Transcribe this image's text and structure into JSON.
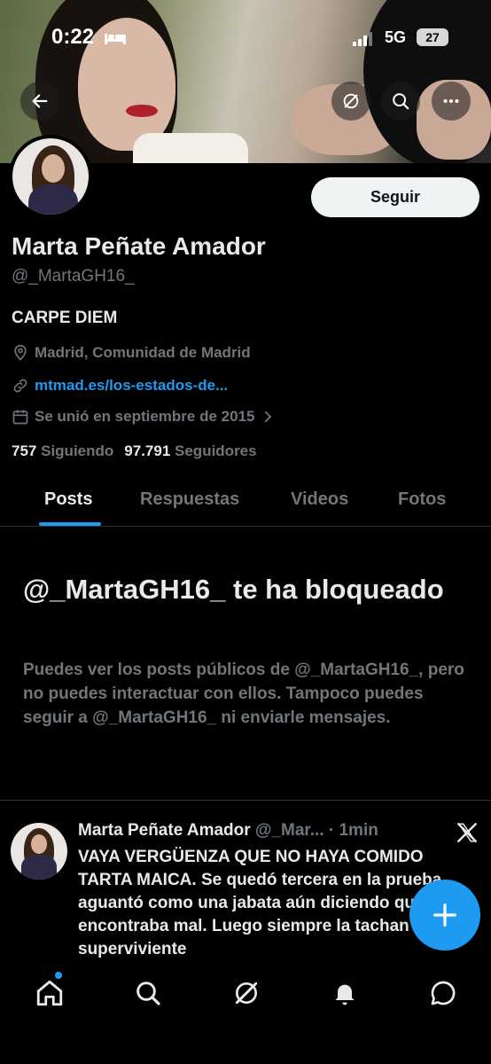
{
  "status_bar": {
    "time": "0:22",
    "network": "5G",
    "battery": "27"
  },
  "profile": {
    "name": "Marta Peñate Amador",
    "handle": "@_MartaGH16_",
    "bio": "CARPE DIEM",
    "location": "Madrid, Comunidad de Madrid",
    "link": "mtmad.es/los-estados-de...",
    "joined": "Se unió en septiembre de 2015",
    "following_count": "757",
    "following_label": "Siguiendo",
    "followers_count": "97.791",
    "followers_label": "Seguidores",
    "follow_button": "Seguir"
  },
  "tabs": [
    {
      "label": "Posts",
      "active": true
    },
    {
      "label": "Respuestas",
      "active": false
    },
    {
      "label": "Videos",
      "active": false
    },
    {
      "label": "Fotos",
      "active": false
    }
  ],
  "blocked": {
    "title": "@_MartaGH16_ te ha bloqueado",
    "description": "Puedes ver los posts públicos de @_MartaGH16_, pero no puedes interactuar con ellos. Tampoco puedes seguir a @_MartaGH16_ ni enviarle mensajes."
  },
  "post": {
    "name": "Marta Peñate Amador",
    "handle_time": "@_Mar... · 1min",
    "text": "VAYA VERGÜENZA QUE NO HAYA COMIDO TARTA MAICA. Se quedó tercera en la prueba, aguantó como una jabata aún diciendo que se encontraba mal. Luego siempre la tachan de mala superviviente"
  },
  "icons": {
    "back": "back-arrow-icon",
    "grok": "grok-icon",
    "search": "search-icon",
    "more": "more-icon",
    "location": "location-pin-icon",
    "link": "link-icon",
    "calendar": "calendar-icon",
    "x_logo": "x-logo-icon",
    "compose": "plus-icon",
    "nav": [
      "home-icon",
      "search-icon",
      "grok-icon",
      "bell-icon",
      "message-icon"
    ]
  },
  "colors": {
    "accent": "#1d9bf0",
    "background": "#000000",
    "text": "#e7e9ea",
    "muted": "#71767b"
  }
}
